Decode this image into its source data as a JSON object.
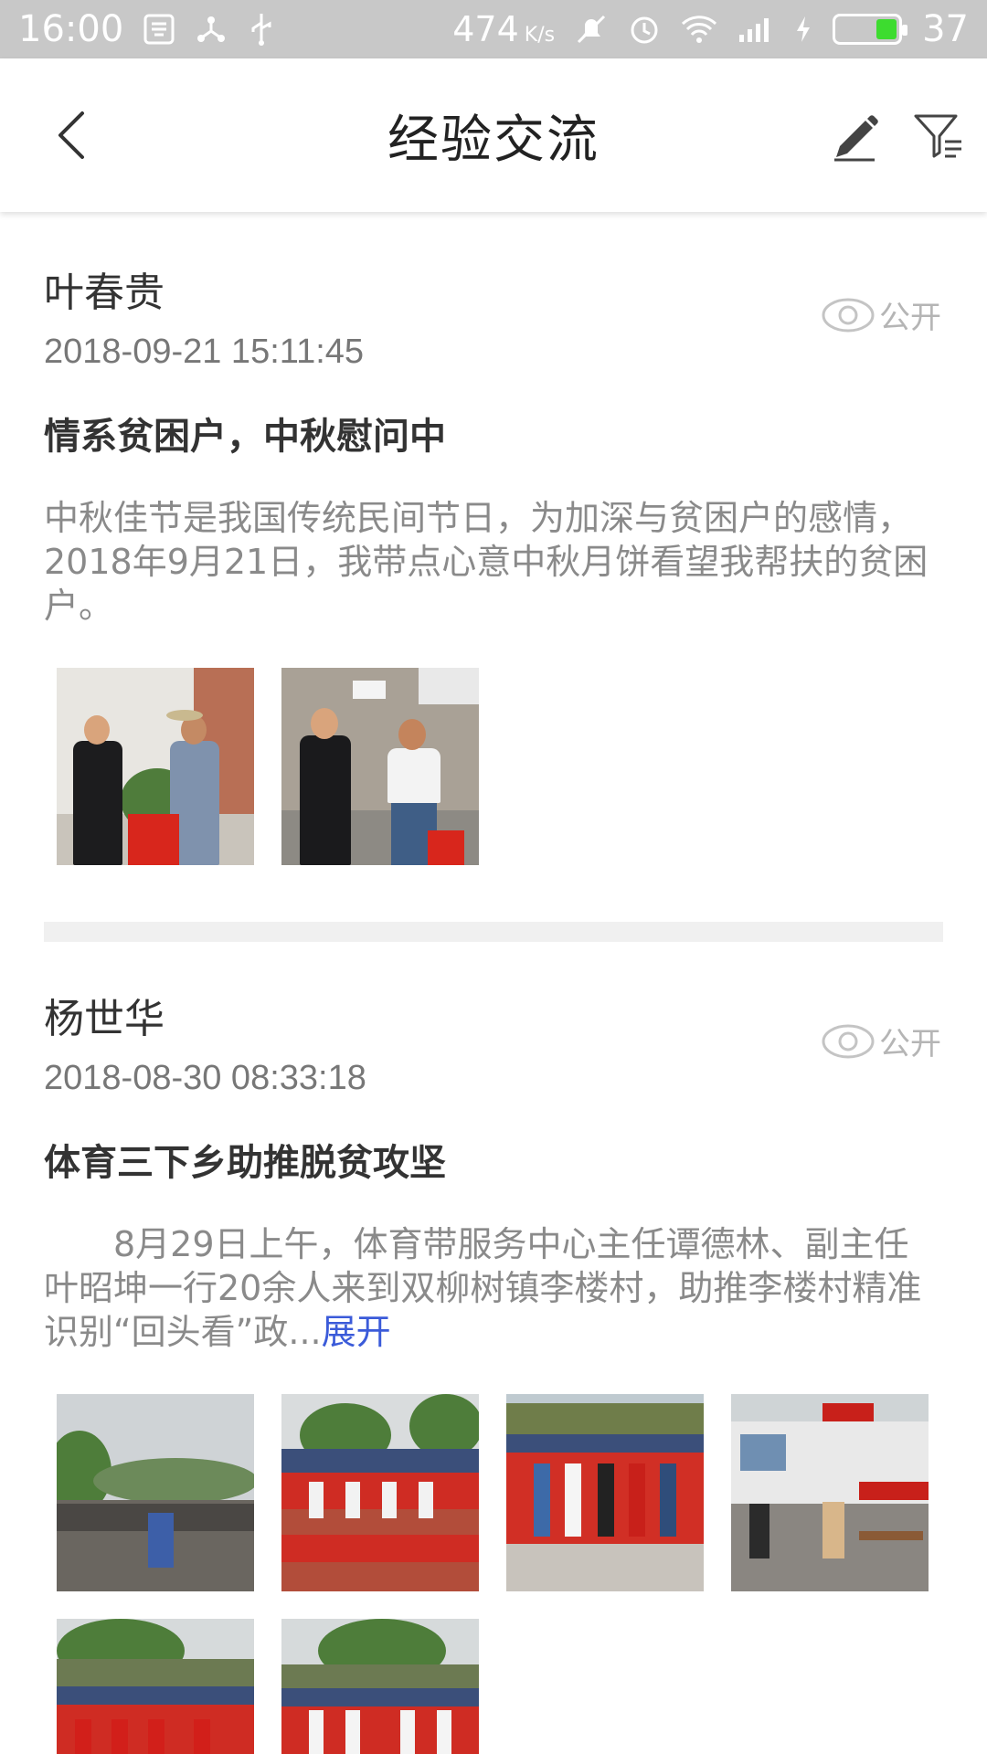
{
  "status_bar": {
    "time": "16:00",
    "net_speed": "474",
    "net_unit": "K/s",
    "battery_level": "37",
    "battery_fill_percent": 35
  },
  "header": {
    "title": "经验交流"
  },
  "posts": [
    {
      "author": "叶春贵",
      "time": "2018-09-21 15:11:45",
      "visibility": "公开",
      "title": "情系贫困户，中秋慰问中",
      "body": "中秋佳节是我国传统民间节日，为加深与贫困户的感情，2018年9月21日，我带点心意中秋月饼看望我帮扶的贫困户。",
      "expand_label": ""
    },
    {
      "author": "杨世华",
      "time": "2018-08-30 08:33:18",
      "visibility": "公开",
      "title": "体育三下乡助推脱贫攻坚",
      "body": "　　8月29日上午，体育带服务中心主任谭德林、副主任叶昭坤一行20余人来到双柳树镇李楼村，助推李楼村精准识别“回头看”政...",
      "expand_label": "展开"
    }
  ],
  "colors": {
    "accent_link": "#3b5bd9",
    "status_bar_bg": "#c8c8c8",
    "divider": "#f0f0f0"
  }
}
